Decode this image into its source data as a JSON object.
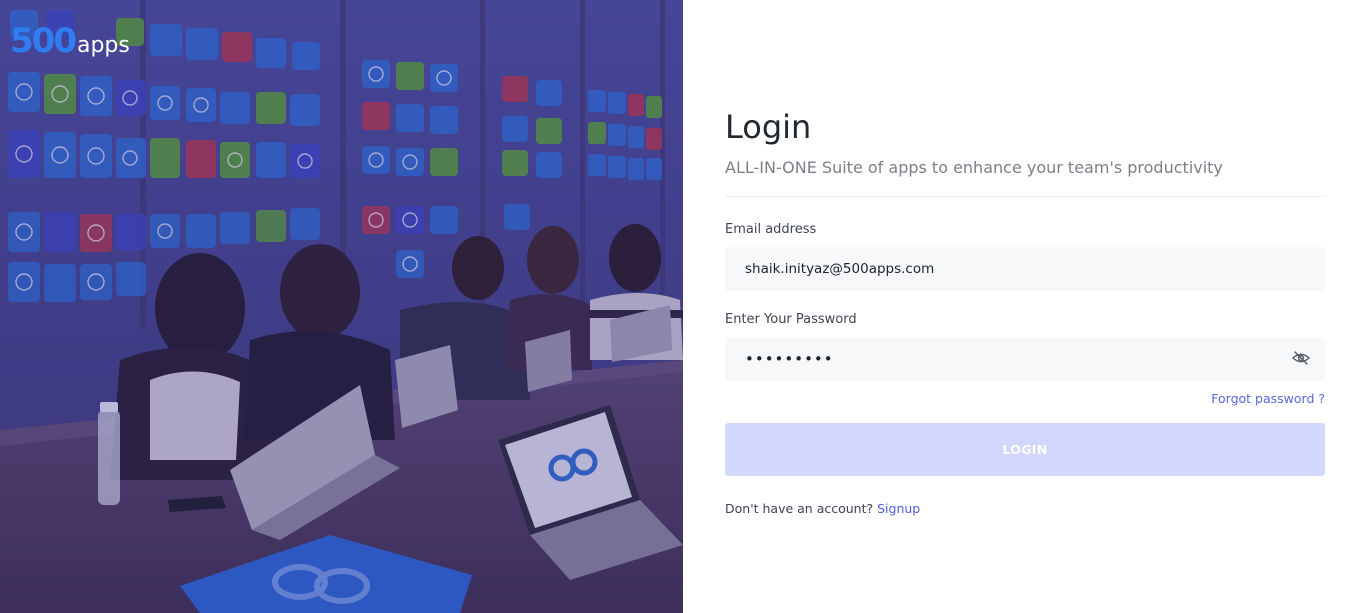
{
  "brand": {
    "logo_number": "500",
    "logo_word": "apps",
    "accent": "#2f7df0"
  },
  "form": {
    "title": "Login",
    "subtitle": "ALL-IN-ONE Suite of apps to enhance your team's productivity",
    "email_label": "Email address",
    "email_value": "shaik.inityaz@500apps.com",
    "password_label": "Enter Your Password",
    "password_value": "123456789",
    "password_toggle_icon": "eye-slash-icon",
    "forgot_label": "Forgot password ?",
    "login_label": "LOGIN",
    "signup_prompt": "Don't have an account?",
    "signup_label": "Signup",
    "button_color": "#d2d7fd",
    "link_color": "#5a66e3"
  }
}
